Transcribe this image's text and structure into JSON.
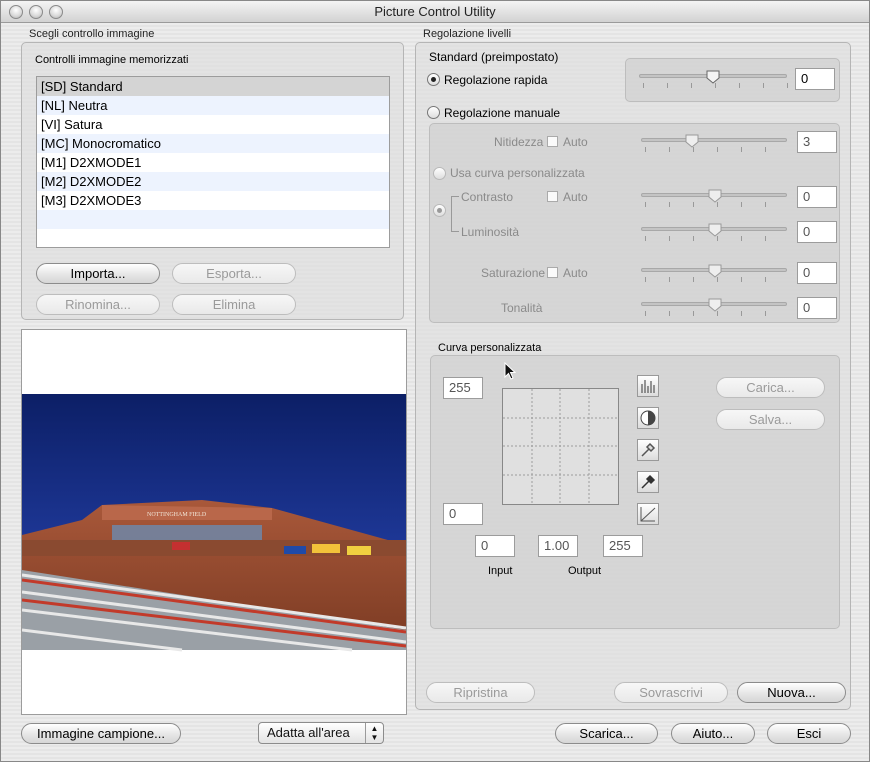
{
  "window": {
    "title": "Picture Control Utility"
  },
  "left": {
    "section_title": "Scegli controllo immagine",
    "stored_title": "Controlli immagine memorizzati",
    "list": [
      "[SD] Standard",
      "[NL] Neutra",
      "[VI] Satura",
      "[MC] Monocromatico",
      "[M1] D2XMODE1",
      "[M2] D2XMODE2",
      "[M3] D2XMODE3"
    ],
    "selected_index": 0,
    "buttons": {
      "import": "Importa...",
      "export": "Esporta...",
      "rename": "Rinomina...",
      "delete": "Elimina"
    },
    "photo": {
      "sign": "NOTTINGHAM FIELD"
    }
  },
  "right": {
    "section_title": "Regolazione livelli",
    "base_name": "Standard (preimpostato)",
    "quick_label": "Regolazione rapida",
    "quick_value": "0",
    "manual_label": "Regolazione manuale",
    "sharpness_label": "Nitidezza",
    "auto_label": "Auto",
    "sharpness_value": "3",
    "custom_curve_option": "Usa curva personalizzata",
    "contrast_label": "Contrasto",
    "contrast_value": "0",
    "brightness_label": "Luminosità",
    "brightness_value": "0",
    "saturation_label": "Saturazione",
    "saturation_value": "0",
    "hue_label": "Tonalità",
    "hue_value": "0",
    "curve": {
      "title": "Curva personalizzata",
      "top_value": "255",
      "bottom_value": "0",
      "input_min": "0",
      "gamma": "1.00",
      "output_max": "255",
      "input_label": "Input",
      "output_label": "Output",
      "load_label": "Carica...",
      "save_label": "Salva..."
    },
    "reset_label": "Ripristina",
    "overwrite_label": "Sovrascrivi",
    "new_label": "Nuova..."
  },
  "bottom": {
    "sample_label": "Immagine campione...",
    "fit_option": "Adatta all'area",
    "download_label": "Scarica...",
    "help_label": "Aiuto...",
    "exit_label": "Esci"
  }
}
